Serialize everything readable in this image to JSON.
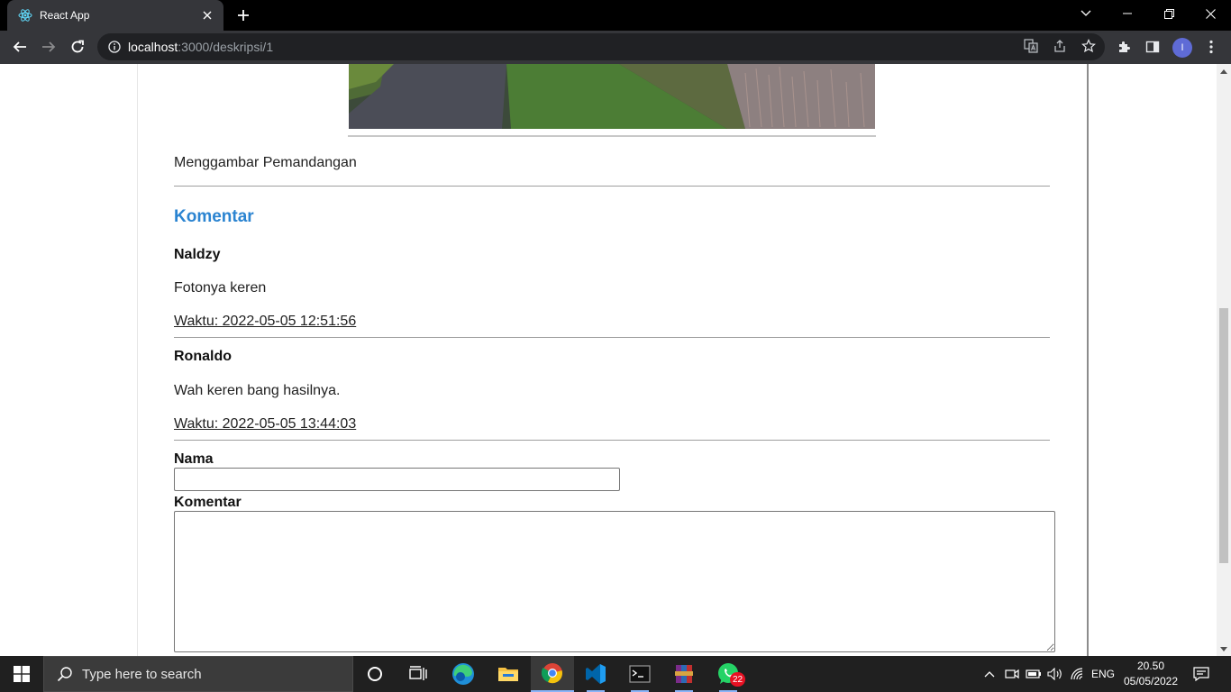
{
  "browser": {
    "tab_title": "React App",
    "url_host": "localhost",
    "url_rest": ":3000/deskripsi/1",
    "profile_initial": "I"
  },
  "post": {
    "description": "Menggambar Pemandangan"
  },
  "comments_section": {
    "title": "Komentar",
    "items": [
      {
        "author": "Naldzy",
        "text": "Fotonya keren",
        "time": "Waktu: 2022-05-05 12:51:56"
      },
      {
        "author": "Ronaldo",
        "text": "Wah keren bang hasilnya.",
        "time": "Waktu: 2022-05-05 13:44:03"
      }
    ]
  },
  "form": {
    "name_label": "Nama",
    "name_value": "",
    "comment_label": "Komentar",
    "comment_value": ""
  },
  "taskbar": {
    "search_placeholder": "Type here to search",
    "whatsapp_badge": "22",
    "language": "ENG",
    "time": "20.50",
    "date": "05/05/2022"
  },
  "colors": {
    "accent_title": "#2b84d1",
    "browser_frame": "#35363a"
  }
}
